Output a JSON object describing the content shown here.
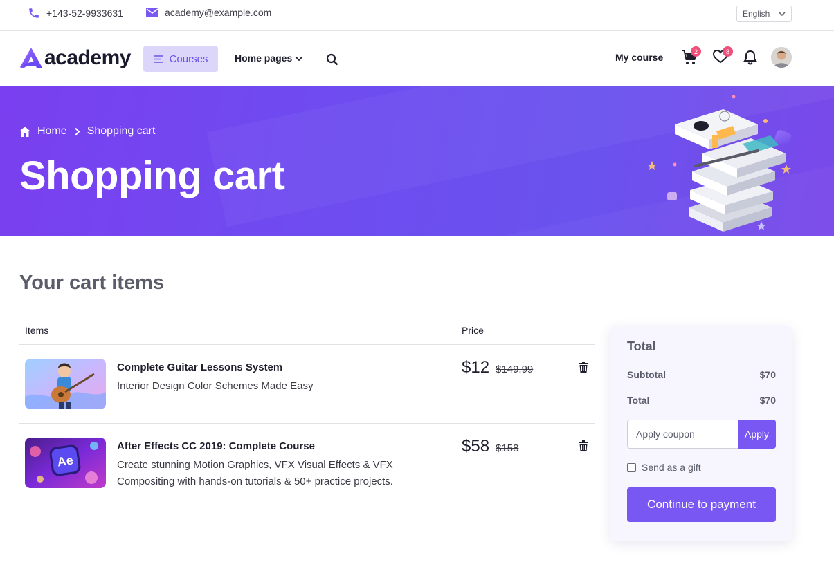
{
  "topbar": {
    "phone": "+143-52-9933631",
    "email": "academy@example.com",
    "language": "English",
    "phone_icon": "phone-icon",
    "email_icon": "envelope-icon"
  },
  "navbar": {
    "logo_text": "academy",
    "courses_label": "Courses",
    "home_pages_label": "Home pages",
    "my_course_label": "My course",
    "cart_count": "2",
    "wishlist_count": "8"
  },
  "hero": {
    "breadcrumb_home": "Home",
    "breadcrumb_current": "Shopping cart",
    "title": "Shopping cart"
  },
  "cart": {
    "title": "Your cart items",
    "columns": {
      "items": "Items",
      "price": "Price"
    },
    "items": [
      {
        "title": "Complete Guitar Lessons System",
        "description": "Interior Design Color Schemes Made Easy",
        "price": "$12",
        "old_price": "$149.99"
      },
      {
        "title": "After Effects CC 2019: Complete Course",
        "description": "Create stunning Motion Graphics, VFX Visual Effects & VFX Compositing with hands-on tutorials & 50+ practice projects.",
        "price": "$58",
        "old_price": "$158"
      }
    ]
  },
  "summary": {
    "heading": "Total",
    "subtotal_label": "Subtotal",
    "subtotal_value": "$70",
    "total_label": "Total",
    "total_value": "$70",
    "coupon_placeholder": "Apply coupon",
    "apply_label": "Apply",
    "gift_label": "Send as a gift",
    "pay_label": "Continue to payment"
  },
  "colors": {
    "primary": "#7857f2",
    "hero": "#6e4cf0",
    "badge": "#f04f79",
    "courses_bg": "#ddd6fb"
  }
}
